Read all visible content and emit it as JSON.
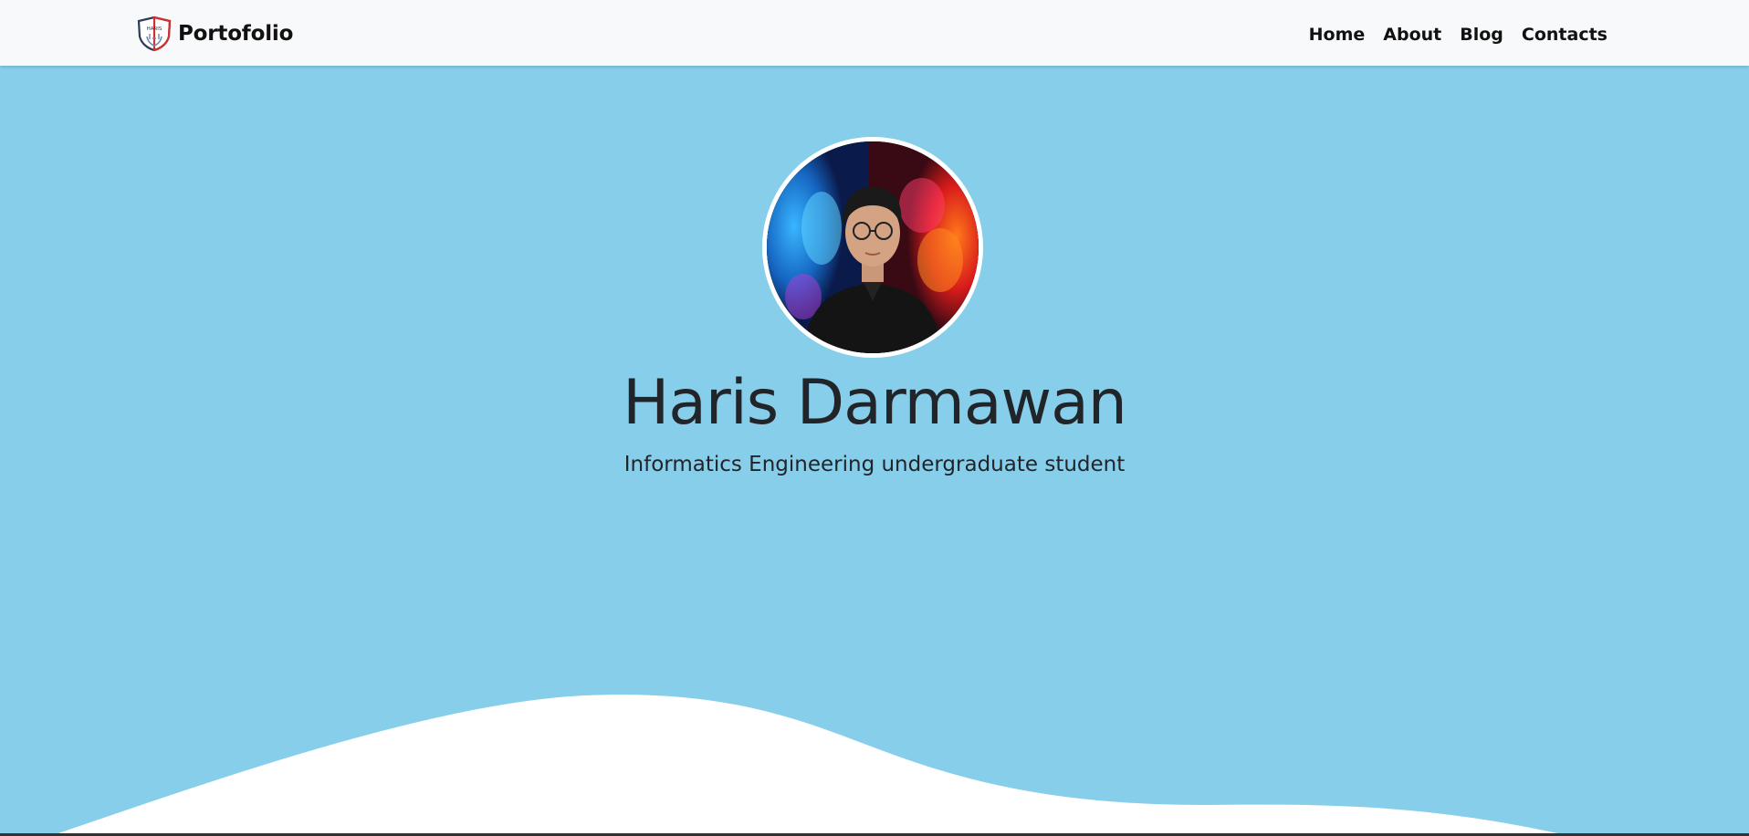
{
  "navbar": {
    "brand": {
      "logo_icon": "shield-logo-icon",
      "logo_text": "HARIS",
      "text": "Portofolio"
    },
    "links": [
      {
        "label": "Home"
      },
      {
        "label": "About"
      },
      {
        "label": "Blog"
      },
      {
        "label": "Contacts"
      }
    ]
  },
  "hero": {
    "avatar_alt": "profile-photo",
    "name": "Haris Darmawan",
    "subtitle": "Informatics Engineering undergraduate student"
  },
  "colors": {
    "hero_background": "#87ceeb",
    "navbar_background": "#f8f9fa",
    "wave": "#ffffff",
    "text": "#212529"
  }
}
